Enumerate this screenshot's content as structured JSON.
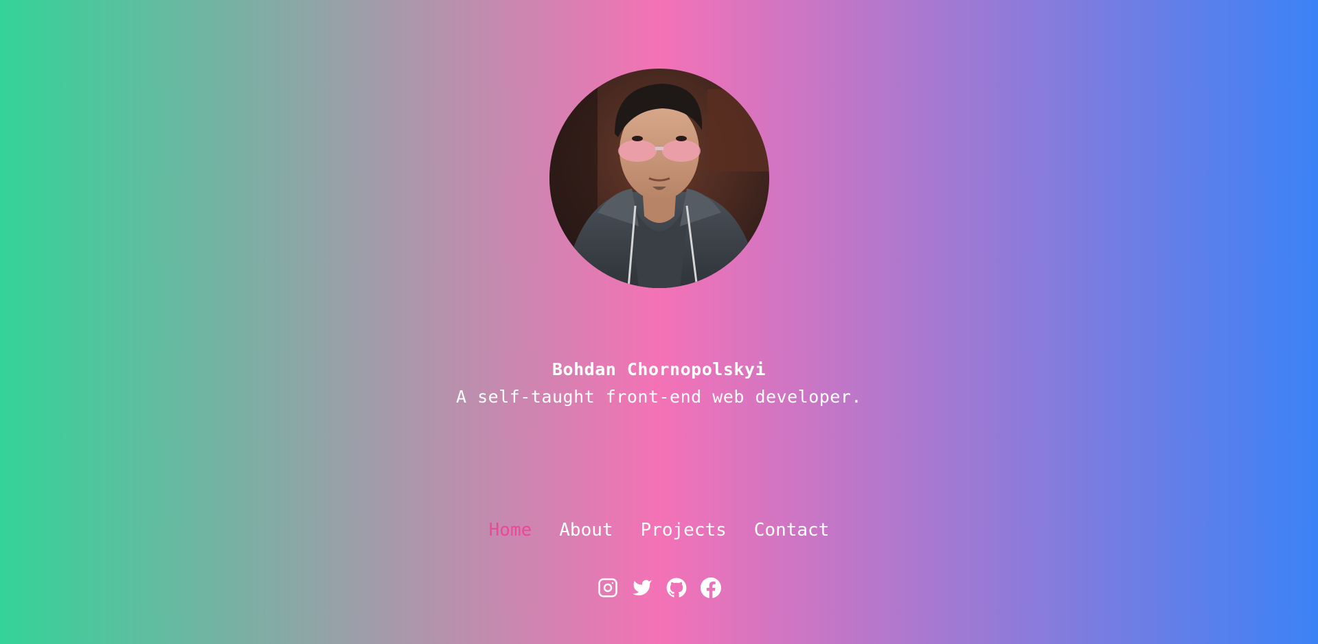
{
  "theme": {
    "gradient_left": "#34d399",
    "gradient_mid": "#f472b6",
    "gradient_right": "#3b82f6",
    "text_color": "#ffffff",
    "active_nav_color": "#ec4899"
  },
  "profile": {
    "name": "Bohdan Chornopolskyi",
    "tagline": "A self-taught front-end web developer.",
    "avatar_icon": "profile-photo"
  },
  "nav": {
    "items": [
      {
        "label": "Home",
        "active": true
      },
      {
        "label": "About",
        "active": false
      },
      {
        "label": "Projects",
        "active": false
      },
      {
        "label": "Contact",
        "active": false
      }
    ]
  },
  "social": {
    "icons": [
      "instagram-icon",
      "twitter-icon",
      "github-icon",
      "facebook-icon"
    ]
  }
}
